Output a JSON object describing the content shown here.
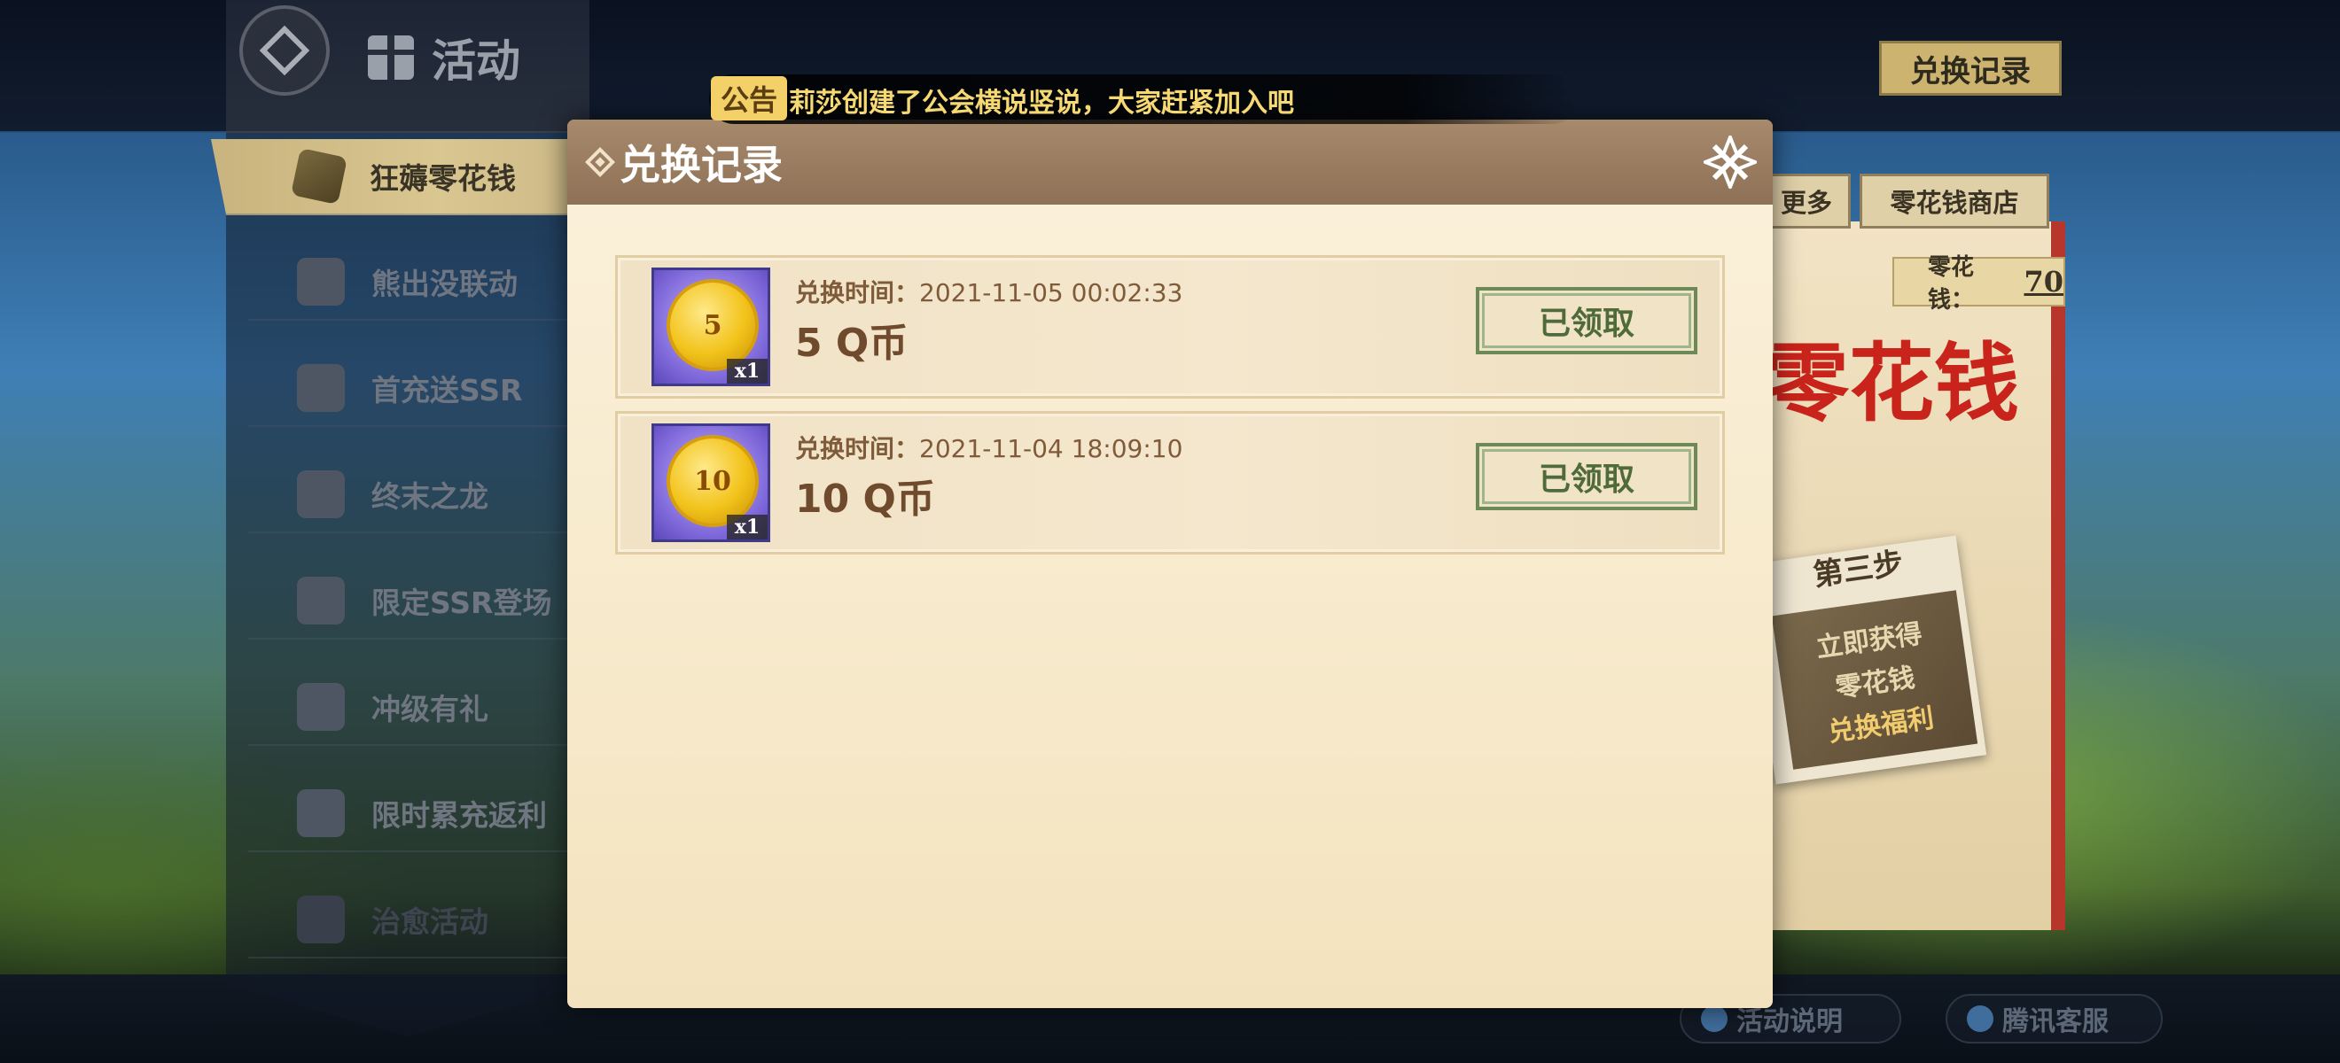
{
  "sidebar": {
    "title": "活动",
    "items": [
      {
        "label": "狂薅零花钱",
        "active": true
      },
      {
        "label": "熊出没联动"
      },
      {
        "label": "首充送SSR"
      },
      {
        "label": "终末之龙"
      },
      {
        "label": "限定SSR登场"
      },
      {
        "label": "冲级有礼"
      },
      {
        "label": "限时累充返利"
      },
      {
        "label": "治愈活动"
      }
    ]
  },
  "top_right": {
    "exchange_record_label": "兑换记录"
  },
  "event": {
    "tabs": [
      "更多",
      "零花钱商店"
    ],
    "money_label": "零花钱：",
    "money_value": "70",
    "big_title": "零花钱",
    "step_title": "第三步",
    "step_lines": [
      "立即获得",
      "零花钱",
      "兑换福利"
    ]
  },
  "bottom": {
    "help_label": "活动说明",
    "cs_label": "腾讯客服"
  },
  "announcement": {
    "badge": "公告",
    "text": "莉莎创建了公会横说竖说，大家赶紧加入吧"
  },
  "modal": {
    "title": "兑换记录",
    "time_label": "兑换时间：",
    "records": [
      {
        "time": "2021-11-05 00:02:33",
        "name": "5 Q币",
        "coin_value": "5",
        "qty": "x1",
        "status": "已领取"
      },
      {
        "time": "2021-11-04 18:09:10",
        "name": "10 Q币",
        "coin_value": "10",
        "qty": "x1",
        "status": "已领取"
      }
    ]
  },
  "colors": {
    "modal_header": "#9a7d61",
    "modal_body": "#f8ecd2",
    "claim_border": "#6c8a57",
    "ticker_text": "#f6d972",
    "active_tab": "#d2bf8a"
  }
}
